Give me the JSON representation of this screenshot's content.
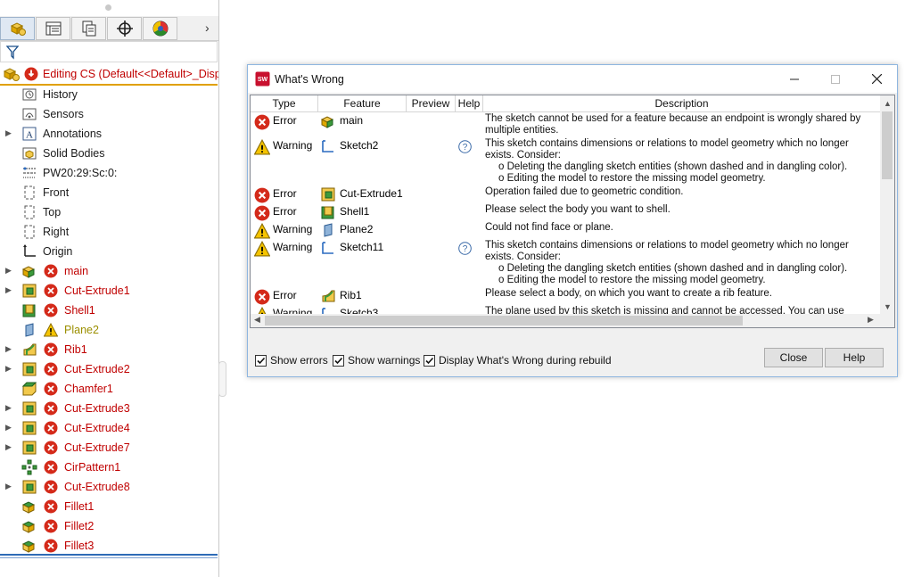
{
  "panel": {
    "tabs": [
      "feature-manager-icon",
      "property-manager-icon",
      "configuration-manager-icon",
      "dimxpert-icon",
      "display-manager-icon"
    ],
    "editing": "Editing CS  (Default<<Default>_Displ",
    "items": [
      {
        "label": "History",
        "icon": "history-folder-icon",
        "expand": false,
        "status": "none"
      },
      {
        "label": "Sensors",
        "icon": "sensors-folder-icon",
        "expand": false,
        "status": "none"
      },
      {
        "label": "Annotations",
        "icon": "annotations-icon",
        "expand": true,
        "status": "none"
      },
      {
        "label": "Solid Bodies",
        "icon": "solid-bodies-icon",
        "expand": false,
        "status": "none"
      },
      {
        "label": "PW20:29:Sc:0:",
        "icon": "material-icon",
        "expand": false,
        "status": "none"
      },
      {
        "label": "Front",
        "icon": "plane-icon",
        "expand": false,
        "status": "none"
      },
      {
        "label": "Top",
        "icon": "plane-icon",
        "expand": false,
        "status": "none"
      },
      {
        "label": "Right",
        "icon": "plane-icon",
        "expand": false,
        "status": "none"
      },
      {
        "label": "Origin",
        "icon": "origin-icon",
        "expand": false,
        "status": "none"
      },
      {
        "label": "main",
        "icon": "extrude-icon",
        "expand": true,
        "status": "error"
      },
      {
        "label": "Cut-Extrude1",
        "icon": "cut-extrude-icon",
        "expand": true,
        "status": "error"
      },
      {
        "label": "Shell1",
        "icon": "shell-icon",
        "expand": false,
        "status": "error"
      },
      {
        "label": "Plane2",
        "icon": "ref-plane-icon",
        "expand": false,
        "status": "warning"
      },
      {
        "label": "Rib1",
        "icon": "rib-icon",
        "expand": true,
        "status": "error"
      },
      {
        "label": "Cut-Extrude2",
        "icon": "cut-extrude-icon",
        "expand": true,
        "status": "error"
      },
      {
        "label": "Chamfer1",
        "icon": "chamfer-icon",
        "expand": false,
        "status": "error"
      },
      {
        "label": "Cut-Extrude3",
        "icon": "cut-extrude-icon",
        "expand": true,
        "status": "error"
      },
      {
        "label": "Cut-Extrude4",
        "icon": "cut-extrude-icon",
        "expand": true,
        "status": "error"
      },
      {
        "label": "Cut-Extrude7",
        "icon": "cut-extrude-icon",
        "expand": true,
        "status": "error"
      },
      {
        "label": "CirPattern1",
        "icon": "circular-pattern-icon",
        "expand": false,
        "status": "error"
      },
      {
        "label": "Cut-Extrude8",
        "icon": "cut-extrude-icon",
        "expand": true,
        "status": "error"
      },
      {
        "label": "Fillet1",
        "icon": "fillet-icon",
        "expand": false,
        "status": "error"
      },
      {
        "label": "Fillet2",
        "icon": "fillet-icon",
        "expand": false,
        "status": "error"
      },
      {
        "label": "Fillet3",
        "icon": "fillet-icon",
        "expand": false,
        "status": "error"
      }
    ]
  },
  "dialog": {
    "title": "What's Wrong",
    "columns": {
      "type": "Type",
      "feature": "Feature",
      "preview": "Preview",
      "help": "Help",
      "description": "Description"
    },
    "rows": [
      {
        "type": "Error",
        "feature": "main",
        "feature_icon": "extrude-icon",
        "help": false,
        "desc": [
          "The sketch cannot be used for a feature because an endpoint is wrongly shared by",
          "multiple entities."
        ],
        "opts": []
      },
      {
        "type": "Warning",
        "feature": "Sketch2",
        "feature_icon": "sketch-icon",
        "help": true,
        "desc": [
          "This sketch contains dimensions or relations to model geometry which no longer",
          "exists.  Consider:"
        ],
        "opts": [
          "o Deleting the dangling sketch entities (shown dashed and in dangling color).",
          "o Editing the model to restore the missing model geometry."
        ]
      },
      {
        "type": "Error",
        "feature": "Cut-Extrude1",
        "feature_icon": "cut-extrude-icon",
        "help": false,
        "desc": [
          "Operation failed due to geometric condition."
        ],
        "opts": []
      },
      {
        "type": "Error",
        "feature": "Shell1",
        "feature_icon": "shell-icon",
        "help": false,
        "desc": [
          "Please select the body you want to shell."
        ],
        "opts": []
      },
      {
        "type": "Warning",
        "feature": "Plane2",
        "feature_icon": "ref-plane-icon",
        "help": false,
        "desc": [
          "Could not find face or plane."
        ],
        "opts": []
      },
      {
        "type": "Warning",
        "feature": "Sketch11",
        "feature_icon": "sketch-icon",
        "help": true,
        "desc": [
          "This sketch contains dimensions or relations to model geometry which no longer",
          "exists.  Consider:"
        ],
        "opts": [
          "o Deleting the dangling sketch entities (shown dashed and in dangling color).",
          "o Editing the model to restore the missing model geometry."
        ]
      },
      {
        "type": "Error",
        "feature": "Rib1",
        "feature_icon": "rib-icon",
        "help": false,
        "desc": [
          "Please select a body, on which you want to create a rib feature."
        ],
        "opts": []
      },
      {
        "type": "Warning",
        "feature": "Sketch3",
        "feature_icon": "sketch-icon",
        "help": false,
        "desc": [
          "The plane used by this sketch is missing and cannot be accessed. You can use"
        ],
        "opts": []
      }
    ],
    "show_errors": "Show errors",
    "show_warnings": "Show warnings",
    "display_during_rebuild": "Display What's Wrong during rebuild",
    "show_errors_checked": true,
    "show_warnings_checked": true,
    "display_during_rebuild_checked": true,
    "close_label": "Close",
    "help_label": "Help"
  },
  "colors": {
    "error": "#c00000",
    "warning_text": "#9b8f00",
    "accent": "#2e6bb6"
  }
}
